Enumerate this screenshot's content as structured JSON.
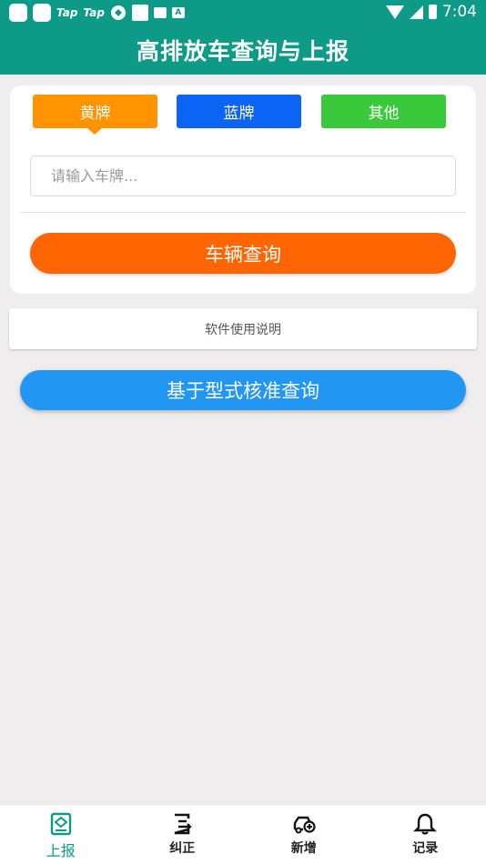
{
  "status_bar": {
    "tap1": "Tap",
    "tap2": "Tap",
    "letter": "A",
    "time": "7:04"
  },
  "header": {
    "title": "高排放车查询与上报"
  },
  "plate_types": [
    {
      "label": "黄牌",
      "color": "#ff9300",
      "selected": true
    },
    {
      "label": "蓝牌",
      "color": "#0c64f5",
      "selected": false
    },
    {
      "label": "其他",
      "color": "#39c93b",
      "selected": false
    }
  ],
  "search": {
    "placeholder": "请输入车牌...",
    "value": ""
  },
  "query_button": {
    "label": "车辆查询",
    "color": "#ff6603"
  },
  "instructions": {
    "label": "软件使用说明"
  },
  "type_approval_button": {
    "label": "基于型式核准查询",
    "color": "#2196f3"
  },
  "bottom_nav": [
    {
      "label": "上报",
      "icon": "report-icon",
      "active": true
    },
    {
      "label": "纠正",
      "icon": "correct-icon",
      "active": false
    },
    {
      "label": "新增",
      "icon": "add-vehicle-icon",
      "active": false
    },
    {
      "label": "记录",
      "icon": "bell-icon",
      "active": false
    }
  ],
  "colors": {
    "primary": "#0d9a86",
    "background": "#efedee"
  }
}
